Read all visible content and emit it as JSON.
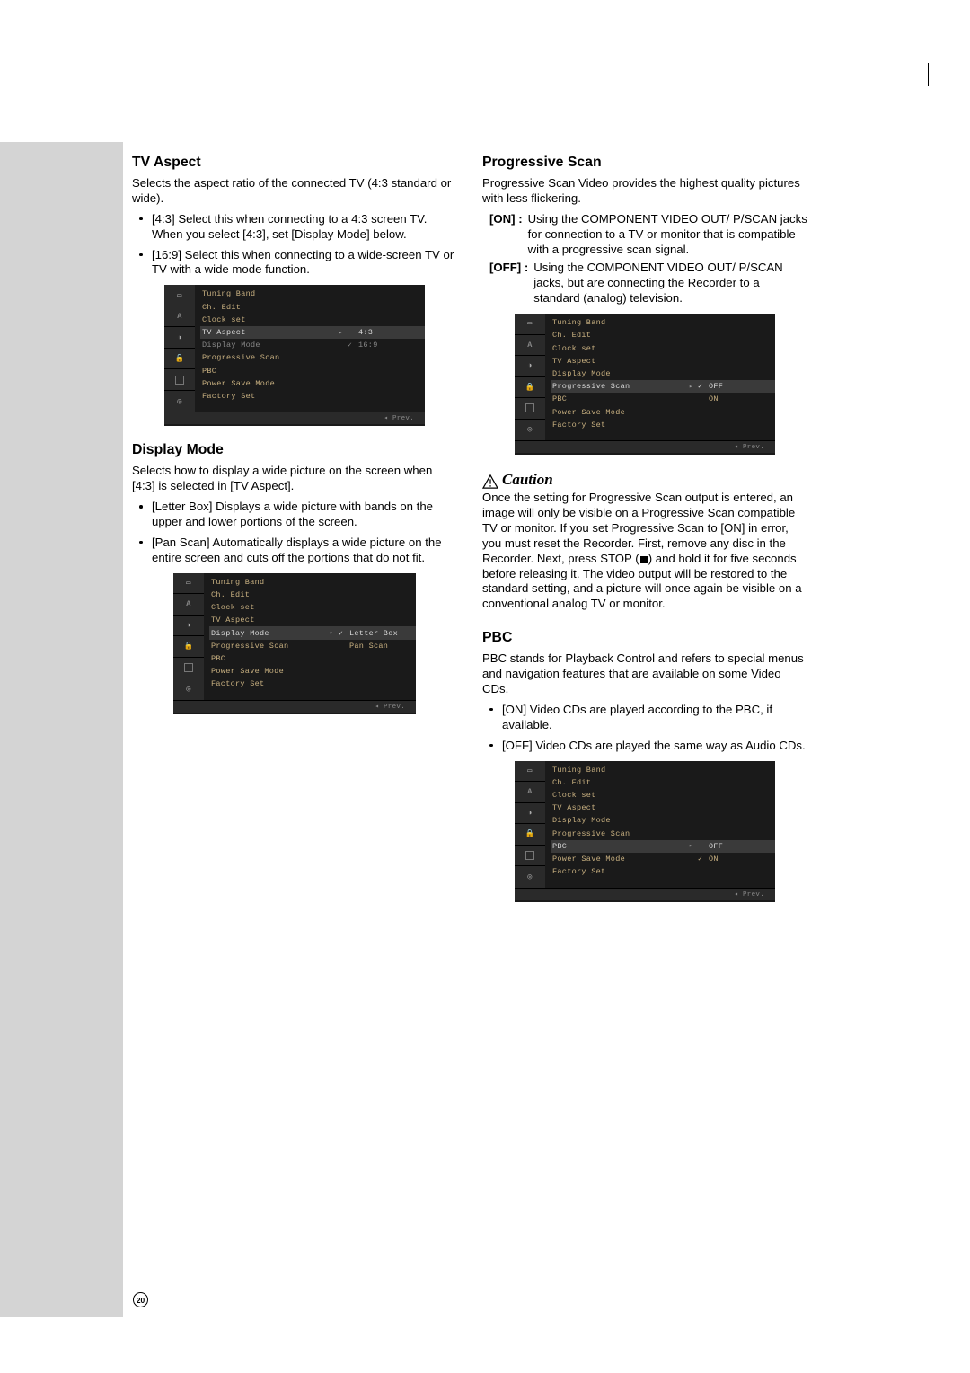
{
  "page_number": "20",
  "left": {
    "tv_aspect": {
      "heading": "TV Aspect",
      "intro": "Selects the aspect ratio of the connected TV (4:3 standard or wide).",
      "items": [
        "[4:3] Select this when connecting to a 4:3 screen TV. When you select [4:3], set [Display Mode] below.",
        "[16:9] Select this when connecting to a wide-screen TV or TV with a wide mode function."
      ]
    },
    "display_mode": {
      "heading": "Display Mode",
      "intro": "Selects how to display a wide picture on the screen when [4:3] is selected in [TV Aspect].",
      "items": [
        "[Letter Box] Displays a wide picture with bands on the upper and lower portions of the screen.",
        "[Pan Scan] Automatically displays a wide picture on the entire screen and cuts off the portions that do not fit."
      ]
    }
  },
  "right": {
    "pscan": {
      "heading": "Progressive Scan",
      "intro": "Progressive Scan Video provides the highest quality pictures with less flickering.",
      "on_label": "[ON]  :",
      "on_text": "Using the COMPONENT VIDEO OUT/ P/SCAN jacks for connection to a TV or monitor that is compatible with a progressive scan signal.",
      "off_label": "[OFF]  :",
      "off_text": "Using the COMPONENT VIDEO OUT/ P/SCAN jacks, but are connecting the Recorder to a standard (analog) television."
    },
    "caution": {
      "word": "Caution",
      "text_a": "Once the setting for Progressive Scan output is entered, an image will only be visible on a Progressive Scan compatible TV or monitor. If you set Progressive Scan to [ON] in error, you must reset the Recorder. First, remove any disc in the Recorder. Next, press STOP (",
      "text_b": ") and hold it for five seconds before releasing it. The video output will be restored to the standard setting, and a picture will once again be visible on a conventional analog TV or monitor."
    },
    "pbc": {
      "heading": "PBC",
      "intro": "PBC stands for Playback Control and refers to special menus and navigation features that are available on some Video CDs.",
      "items": [
        "[ON] Video CDs are played according to the PBC, if available.",
        "[OFF] Video CDs are played the same way as Audio CDs."
      ]
    }
  },
  "menus": {
    "common_items": [
      "Tuning Band",
      "Ch. Edit",
      "Clock set",
      "TV Aspect",
      "Display Mode",
      "Progressive Scan",
      "PBC",
      "Power Save Mode",
      "Factory Set"
    ],
    "prev": "◂ Prev.",
    "aspect": {
      "selected": "TV Aspect",
      "opts": [
        {
          "label": "4:3",
          "checked": false
        },
        {
          "label": "16:9",
          "checked": true
        }
      ]
    },
    "display": {
      "selected": "Display Mode",
      "opts": [
        {
          "label": "Letter Box",
          "checked": true
        },
        {
          "label": "Pan Scan",
          "checked": false
        }
      ]
    },
    "pscan": {
      "selected": "Progressive Scan",
      "opts": [
        {
          "label": "OFF",
          "checked": true
        },
        {
          "label": "ON",
          "checked": false
        }
      ]
    },
    "pbc": {
      "selected": "PBC",
      "opts": [
        {
          "label": "OFF",
          "checked": false
        },
        {
          "label": "ON",
          "checked": true
        }
      ]
    }
  }
}
